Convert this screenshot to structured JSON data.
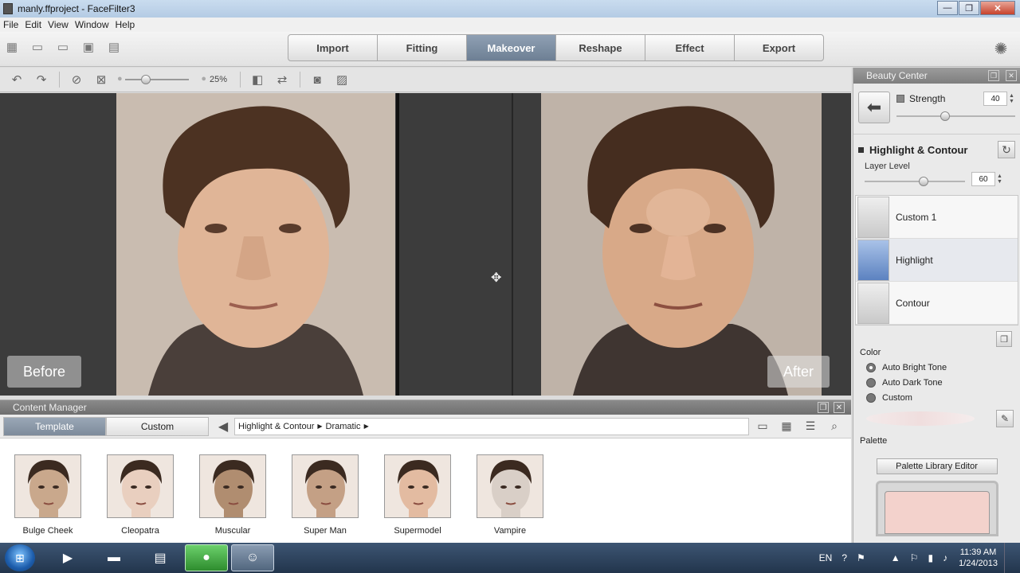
{
  "window": {
    "title": "manly.ffproject - FaceFilter3",
    "minimize": "—",
    "maximize": "❐",
    "close": "✕"
  },
  "menu": [
    "File",
    "Edit",
    "View",
    "Window",
    "Help"
  ],
  "main_tabs": [
    {
      "label": "Import",
      "active": false
    },
    {
      "label": "Fitting",
      "active": false
    },
    {
      "label": "Makeover",
      "active": true
    },
    {
      "label": "Reshape",
      "active": false
    },
    {
      "label": "Effect",
      "active": false
    },
    {
      "label": "Export",
      "active": false
    }
  ],
  "view_toolbar": {
    "zoom_percent": "25%",
    "zoom_level": 0.25
  },
  "canvas": {
    "before_label": "Before",
    "after_label": "After"
  },
  "content_manager": {
    "title": "Content Manager",
    "tabs": [
      {
        "label": "Template",
        "active": true
      },
      {
        "label": "Custom",
        "active": false
      }
    ],
    "breadcrumb": [
      "Highlight & Contour",
      "Dramatic"
    ],
    "items": [
      {
        "label": "Bulge Cheek",
        "tone": "#c9a88c"
      },
      {
        "label": "Cleopatra",
        "tone": "#e9cfbf"
      },
      {
        "label": "Muscular",
        "tone": "#b08d70"
      },
      {
        "label": "Super Man",
        "tone": "#c4a085"
      },
      {
        "label": "Supermodel",
        "tone": "#e3bba1"
      },
      {
        "label": "Vampire",
        "tone": "#d9cfc7"
      }
    ]
  },
  "beauty_center": {
    "title": "Beauty Center",
    "strength_label": "Strength",
    "strength_value": "40",
    "strength_level": 0.4,
    "section_title": "Highlight & Contour",
    "layer_level_label": "Layer Level",
    "layer_level_value": "60",
    "layer_level": 0.6,
    "layers": [
      {
        "name": "Custom 1",
        "selected": false
      },
      {
        "name": "Highlight",
        "selected": true
      },
      {
        "name": "Contour",
        "selected": false
      }
    ],
    "color_label": "Color",
    "color_options": [
      {
        "label": "Auto Bright Tone",
        "selected": true
      },
      {
        "label": "Auto Dark Tone",
        "selected": false
      },
      {
        "label": "Custom",
        "selected": false
      }
    ],
    "palette_label": "Palette",
    "palette_button": "Palette Library Editor",
    "palette_color": "#f3d2cc"
  },
  "taskbar": {
    "language": "EN",
    "time": "11:39 AM",
    "date": "1/24/2013"
  },
  "colors": {
    "active_tab": "#7a8ba0",
    "canvas_bg": "#3c3c3c",
    "taskbar": "#2c405a"
  }
}
